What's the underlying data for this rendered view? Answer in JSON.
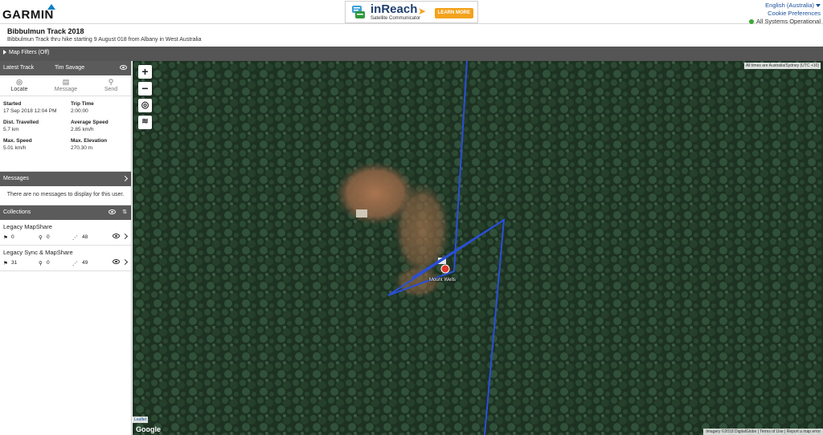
{
  "header": {
    "logo_text": "GARMIN",
    "ad": {
      "title": "inReach",
      "subtitle": "Satellite Communicator",
      "button": "LEARN MORE"
    },
    "language": "English (Australia)",
    "cookie_link": "Cookie Preferences",
    "system_status": "All Systems Operational",
    "status_color": "#3aaa35"
  },
  "page": {
    "title": "Bibbulmun Track 2018",
    "subtitle": "Bibbulmun Track thru hike starting 9 August 018 from Albany in West Australia"
  },
  "filters": {
    "label": "Map Filters (Off)"
  },
  "sidebar": {
    "latest_track": {
      "heading": "Latest Track",
      "user": "Tim Savage",
      "actions": [
        {
          "label": "Locate",
          "icon": "target-icon"
        },
        {
          "label": "Message",
          "icon": "message-icon"
        },
        {
          "label": "Send",
          "icon": "pin-icon"
        }
      ],
      "stats": {
        "started_label": "Started",
        "started_value": "17 Sep 2018 12:04 PM",
        "trip_time_label": "Trip Time",
        "trip_time_value": "2:00:00",
        "distance_label": "Dist. Travelled",
        "distance_value": "5.7 km",
        "avg_speed_label": "Average Speed",
        "avg_speed_value": "2.85 km/h",
        "max_speed_label": "Max. Speed",
        "max_speed_value": "5.01 km/h",
        "max_elev_label": "Max. Elevation",
        "max_elev_value": "270.30 m"
      }
    },
    "messages": {
      "heading": "Messages",
      "empty_text": "There are no messages to display for this user."
    },
    "collections": {
      "heading": "Collections",
      "items": [
        {
          "name": "Legacy MapShare",
          "flags": "0",
          "waypoints": "0",
          "tracks": "48"
        },
        {
          "name": "Legacy Sync & MapShare",
          "flags": "31",
          "waypoints": "0",
          "tracks": "49"
        }
      ]
    }
  },
  "map": {
    "timezone_note": "All times are Australia/Sydney (UTC +10)",
    "waypoint_label": "Mount Wells",
    "leaflet_label": "Leaflet",
    "google_label": "Google",
    "attribution": "Imagery ©2018 DigitalGlobe  |  Terms of Use  |  Report a map error",
    "track_color": "#2a4fd8",
    "waypoint_color": "#e0362c"
  }
}
